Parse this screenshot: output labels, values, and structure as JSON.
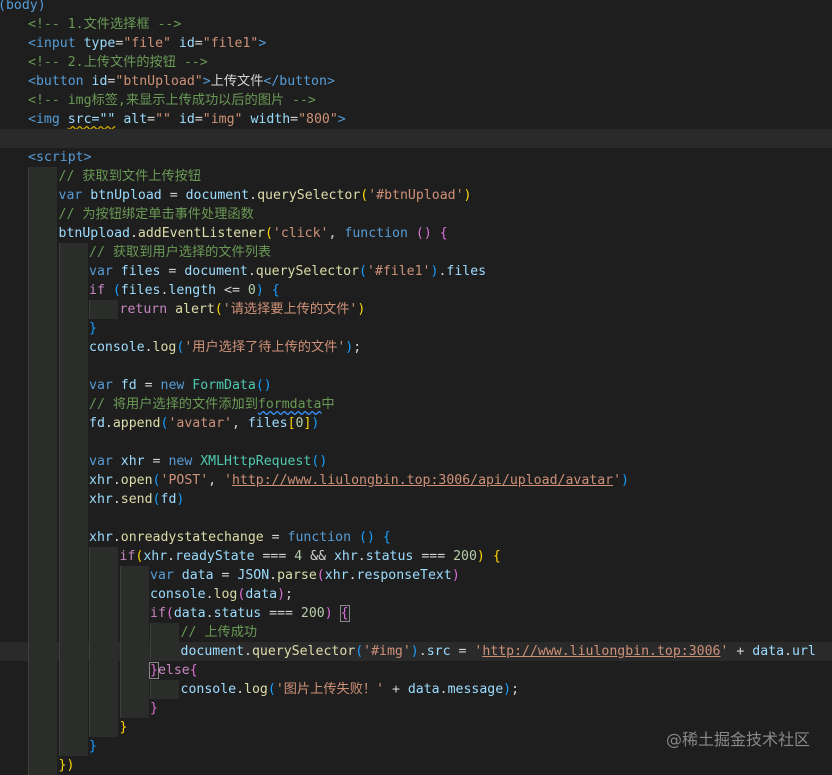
{
  "watermark": "@稀土掘金技术社区",
  "lines": [
    {
      "indent": 0,
      "tokens": [
        [
          "(body)",
          "t-tag"
        ]
      ]
    },
    {
      "indent": 0,
      "tokens": [
        [
          "<!-- 1.文件选择框 -->",
          "t-cmt"
        ]
      ]
    },
    {
      "indent": 0,
      "tokens": [
        [
          "<input",
          "t-tag"
        ],
        [
          " ",
          "t-txt"
        ],
        [
          "type",
          "t-attr"
        ],
        [
          "=",
          "t-txt"
        ],
        [
          "\"file\"",
          "t-str"
        ],
        [
          " ",
          "t-txt"
        ],
        [
          "id",
          "t-attr"
        ],
        [
          "=",
          "t-txt"
        ],
        [
          "\"file1\"",
          "t-str"
        ],
        [
          ">",
          "t-tag"
        ]
      ]
    },
    {
      "indent": 0,
      "tokens": [
        [
          "<!-- 2.上传文件的按钮 -->",
          "t-cmt"
        ]
      ]
    },
    {
      "indent": 0,
      "tokens": [
        [
          "<button",
          "t-tag"
        ],
        [
          " ",
          "t-txt"
        ],
        [
          "id",
          "t-attr"
        ],
        [
          "=",
          "t-txt"
        ],
        [
          "\"btnUpload\"",
          "t-str"
        ],
        [
          ">",
          "t-tag"
        ],
        [
          "上传文件",
          "t-txt"
        ],
        [
          "</button>",
          "t-tag"
        ]
      ]
    },
    {
      "indent": 0,
      "tokens": [
        [
          "<!-- img标签,来显示上传成功以后的图片 -->",
          "t-cmt"
        ]
      ]
    },
    {
      "indent": 0,
      "tokens": [
        [
          "<img",
          "t-tag"
        ],
        [
          " ",
          "t-txt"
        ],
        [
          "src=\"\"",
          "t-attr t-sq"
        ],
        [
          " ",
          "t-txt"
        ],
        [
          "alt",
          "t-attr"
        ],
        [
          "=",
          "t-txt"
        ],
        [
          "\"\"",
          "t-str"
        ],
        [
          " ",
          "t-txt"
        ],
        [
          "id",
          "t-attr"
        ],
        [
          "=",
          "t-txt"
        ],
        [
          "\"img\"",
          "t-str"
        ],
        [
          " ",
          "t-txt"
        ],
        [
          "width",
          "t-attr"
        ],
        [
          "=",
          "t-txt"
        ],
        [
          "\"800\"",
          "t-str"
        ],
        [
          ">",
          "t-tag"
        ]
      ]
    },
    {
      "indent": 0,
      "tokens": [],
      "cur": true
    },
    {
      "indent": 0,
      "tokens": [
        [
          "<script>",
          "t-tag"
        ]
      ]
    },
    {
      "indent": 1,
      "tokens": [
        [
          "// 获取到文件上传按钮",
          "t-cmt"
        ]
      ]
    },
    {
      "indent": 1,
      "tokens": [
        [
          "var",
          "t-kw"
        ],
        [
          " ",
          "t-txt"
        ],
        [
          "btnUpload",
          "t-var"
        ],
        [
          " = ",
          "t-txt"
        ],
        [
          "document",
          "t-var"
        ],
        [
          ".",
          "t-txt"
        ],
        [
          "querySelector",
          "t-fn"
        ],
        [
          "(",
          "t-p1"
        ],
        [
          "'#btnUpload'",
          "t-str"
        ],
        [
          ")",
          "t-p1"
        ]
      ]
    },
    {
      "indent": 1,
      "tokens": [
        [
          "// 为按钮绑定单击事件处理函数",
          "t-cmt"
        ]
      ]
    },
    {
      "indent": 1,
      "tokens": [
        [
          "btnUpload",
          "t-var"
        ],
        [
          ".",
          "t-txt"
        ],
        [
          "addEventListener",
          "t-fn"
        ],
        [
          "(",
          "t-p1"
        ],
        [
          "'click'",
          "t-str"
        ],
        [
          ", ",
          "t-txt"
        ],
        [
          "function",
          "t-kw"
        ],
        [
          " ",
          "t-txt"
        ],
        [
          "()",
          "t-p2"
        ],
        [
          " ",
          "t-txt"
        ],
        [
          "{",
          "t-p2"
        ]
      ]
    },
    {
      "indent": 2,
      "tokens": [
        [
          "// 获取到用户选择的文件列表",
          "t-cmt"
        ]
      ]
    },
    {
      "indent": 2,
      "tokens": [
        [
          "var",
          "t-kw"
        ],
        [
          " ",
          "t-txt"
        ],
        [
          "files",
          "t-var"
        ],
        [
          " = ",
          "t-txt"
        ],
        [
          "document",
          "t-var"
        ],
        [
          ".",
          "t-txt"
        ],
        [
          "querySelector",
          "t-fn"
        ],
        [
          "(",
          "t-p3"
        ],
        [
          "'#file1'",
          "t-str"
        ],
        [
          ")",
          "t-p3"
        ],
        [
          ".",
          "t-txt"
        ],
        [
          "files",
          "t-var"
        ]
      ]
    },
    {
      "indent": 2,
      "tokens": [
        [
          "if",
          "t-ctl"
        ],
        [
          " ",
          "t-txt"
        ],
        [
          "(",
          "t-p3"
        ],
        [
          "files",
          "t-var"
        ],
        [
          ".",
          "t-txt"
        ],
        [
          "length",
          "t-var"
        ],
        [
          " <= ",
          "t-txt"
        ],
        [
          "0",
          "t-num"
        ],
        [
          ")",
          "t-p3"
        ],
        [
          " ",
          "t-txt"
        ],
        [
          "{",
          "t-p3"
        ]
      ]
    },
    {
      "indent": 3,
      "tokens": [
        [
          "return",
          "t-ctl"
        ],
        [
          " ",
          "t-txt"
        ],
        [
          "alert",
          "t-fn"
        ],
        [
          "(",
          "t-p1"
        ],
        [
          "'请选择要上传的文件'",
          "t-str"
        ],
        [
          ")",
          "t-p1"
        ]
      ]
    },
    {
      "indent": 2,
      "tokens": [
        [
          "}",
          "t-p3"
        ]
      ]
    },
    {
      "indent": 2,
      "tokens": [
        [
          "console",
          "t-var"
        ],
        [
          ".",
          "t-txt"
        ],
        [
          "log",
          "t-fn"
        ],
        [
          "(",
          "t-p3"
        ],
        [
          "'用户选择了待上传的文件'",
          "t-str"
        ],
        [
          ")",
          "t-p3"
        ],
        [
          ";",
          "t-txt"
        ]
      ]
    },
    {
      "indent": 2,
      "tokens": []
    },
    {
      "indent": 2,
      "tokens": [
        [
          "var",
          "t-kw"
        ],
        [
          " ",
          "t-txt"
        ],
        [
          "fd",
          "t-var"
        ],
        [
          " = ",
          "t-txt"
        ],
        [
          "new",
          "t-kw"
        ],
        [
          " ",
          "t-txt"
        ],
        [
          "FormData",
          "t-cls"
        ],
        [
          "()",
          "t-p3"
        ]
      ]
    },
    {
      "indent": 2,
      "tokens": [
        [
          "// 将用户选择的文件添加到",
          "t-cmt"
        ],
        [
          "formdata",
          "t-cmt t-sq2"
        ],
        [
          "中",
          "t-cmt"
        ]
      ]
    },
    {
      "indent": 2,
      "tokens": [
        [
          "fd",
          "t-var"
        ],
        [
          ".",
          "t-txt"
        ],
        [
          "append",
          "t-fn"
        ],
        [
          "(",
          "t-p3"
        ],
        [
          "'avatar'",
          "t-str"
        ],
        [
          ", ",
          "t-txt"
        ],
        [
          "files",
          "t-var"
        ],
        [
          "[",
          "t-p1"
        ],
        [
          "0",
          "t-num"
        ],
        [
          "]",
          "t-p1"
        ],
        [
          ")",
          "t-p3"
        ]
      ]
    },
    {
      "indent": 2,
      "tokens": []
    },
    {
      "indent": 2,
      "tokens": [
        [
          "var",
          "t-kw"
        ],
        [
          " ",
          "t-txt"
        ],
        [
          "xhr",
          "t-var"
        ],
        [
          " = ",
          "t-txt"
        ],
        [
          "new",
          "t-kw"
        ],
        [
          " ",
          "t-txt"
        ],
        [
          "XMLHttpRequest",
          "t-cls"
        ],
        [
          "()",
          "t-p3"
        ]
      ]
    },
    {
      "indent": 2,
      "tokens": [
        [
          "xhr",
          "t-var"
        ],
        [
          ".",
          "t-txt"
        ],
        [
          "open",
          "t-fn"
        ],
        [
          "(",
          "t-p3"
        ],
        [
          "'POST'",
          "t-str"
        ],
        [
          ", ",
          "t-txt"
        ],
        [
          "'",
          "t-str"
        ],
        [
          "http://www.liulongbin.top:3006/api/upload/avatar",
          "t-url"
        ],
        [
          "'",
          "t-str"
        ],
        [
          ")",
          "t-p3"
        ]
      ]
    },
    {
      "indent": 2,
      "tokens": [
        [
          "xhr",
          "t-var"
        ],
        [
          ".",
          "t-txt"
        ],
        [
          "send",
          "t-fn"
        ],
        [
          "(",
          "t-p3"
        ],
        [
          "fd",
          "t-var"
        ],
        [
          ")",
          "t-p3"
        ]
      ]
    },
    {
      "indent": 2,
      "tokens": []
    },
    {
      "indent": 2,
      "tokens": [
        [
          "xhr",
          "t-var"
        ],
        [
          ".",
          "t-txt"
        ],
        [
          "onreadystatechange",
          "t-fn"
        ],
        [
          " = ",
          "t-txt"
        ],
        [
          "function",
          "t-kw"
        ],
        [
          " ",
          "t-txt"
        ],
        [
          "()",
          "t-p3"
        ],
        [
          " ",
          "t-txt"
        ],
        [
          "{",
          "t-p3"
        ]
      ]
    },
    {
      "indent": 3,
      "tokens": [
        [
          "if",
          "t-ctl"
        ],
        [
          "(",
          "t-p1"
        ],
        [
          "xhr",
          "t-var"
        ],
        [
          ".",
          "t-txt"
        ],
        [
          "readyState",
          "t-var"
        ],
        [
          " === ",
          "t-txt"
        ],
        [
          "4",
          "t-num"
        ],
        [
          " && ",
          "t-txt"
        ],
        [
          "xhr",
          "t-var"
        ],
        [
          ".",
          "t-txt"
        ],
        [
          "status",
          "t-var"
        ],
        [
          " === ",
          "t-txt"
        ],
        [
          "200",
          "t-num"
        ],
        [
          ")",
          "t-p1"
        ],
        [
          " ",
          "t-txt"
        ],
        [
          "{",
          "t-p1"
        ]
      ]
    },
    {
      "indent": 4,
      "tokens": [
        [
          "var",
          "t-kw"
        ],
        [
          " ",
          "t-txt"
        ],
        [
          "data",
          "t-var"
        ],
        [
          " = ",
          "t-txt"
        ],
        [
          "JSON",
          "t-var"
        ],
        [
          ".",
          "t-txt"
        ],
        [
          "parse",
          "t-fn"
        ],
        [
          "(",
          "t-p2"
        ],
        [
          "xhr",
          "t-var"
        ],
        [
          ".",
          "t-txt"
        ],
        [
          "responseText",
          "t-var"
        ],
        [
          ")",
          "t-p2"
        ]
      ]
    },
    {
      "indent": 4,
      "tokens": [
        [
          "console",
          "t-var"
        ],
        [
          ".",
          "t-txt"
        ],
        [
          "log",
          "t-fn"
        ],
        [
          "(",
          "t-p2"
        ],
        [
          "data",
          "t-var"
        ],
        [
          ")",
          "t-p2"
        ],
        [
          ";",
          "t-txt"
        ]
      ]
    },
    {
      "indent": 4,
      "tokens": [
        [
          "if",
          "t-ctl"
        ],
        [
          "(",
          "t-p2"
        ],
        [
          "data",
          "t-var"
        ],
        [
          ".",
          "t-txt"
        ],
        [
          "status",
          "t-var"
        ],
        [
          " === ",
          "t-txt"
        ],
        [
          "200",
          "t-num"
        ],
        [
          ")",
          "t-p2"
        ],
        [
          " ",
          "t-txt"
        ],
        [
          "{",
          "t-p2 t-box"
        ]
      ]
    },
    {
      "indent": 5,
      "tokens": [
        [
          "// 上传成功",
          "t-cmt"
        ]
      ]
    },
    {
      "indent": 5,
      "tokens": [
        [
          "document",
          "t-var"
        ],
        [
          ".",
          "t-txt"
        ],
        [
          "querySelector",
          "t-fn"
        ],
        [
          "(",
          "t-p3"
        ],
        [
          "'#img'",
          "t-str"
        ],
        [
          ")",
          "t-p3"
        ],
        [
          ".",
          "t-txt"
        ],
        [
          "src",
          "t-var"
        ],
        [
          " = ",
          "t-txt"
        ],
        [
          "'",
          "t-str"
        ],
        [
          "http://www.liulongbin.top:3006",
          "t-url"
        ],
        [
          "'",
          "t-str"
        ],
        [
          " + ",
          "t-txt"
        ],
        [
          "data",
          "t-var"
        ],
        [
          ".",
          "t-txt"
        ],
        [
          "url",
          "t-var"
        ]
      ],
      "cur": true
    },
    {
      "indent": 4,
      "tokens": [
        [
          "}",
          "t-p2 t-box"
        ],
        [
          "else",
          "t-ctl"
        ],
        [
          "{",
          "t-p2"
        ]
      ]
    },
    {
      "indent": 5,
      "tokens": [
        [
          "console",
          "t-var"
        ],
        [
          ".",
          "t-txt"
        ],
        [
          "log",
          "t-fn"
        ],
        [
          "(",
          "t-p3"
        ],
        [
          "'图片上传失败！'",
          "t-str"
        ],
        [
          " + ",
          "t-txt"
        ],
        [
          "data",
          "t-var"
        ],
        [
          ".",
          "t-txt"
        ],
        [
          "message",
          "t-var"
        ],
        [
          ")",
          "t-p3"
        ],
        [
          ";",
          "t-txt"
        ]
      ]
    },
    {
      "indent": 4,
      "tokens": [
        [
          "}",
          "t-p2"
        ]
      ]
    },
    {
      "indent": 3,
      "tokens": [
        [
          "}",
          "t-p1"
        ]
      ]
    },
    {
      "indent": 2,
      "tokens": [
        [
          "}",
          "t-p3"
        ]
      ]
    },
    {
      "indent": 1,
      "tokens": [
        [
          "})",
          "t-p1"
        ]
      ]
    }
  ]
}
